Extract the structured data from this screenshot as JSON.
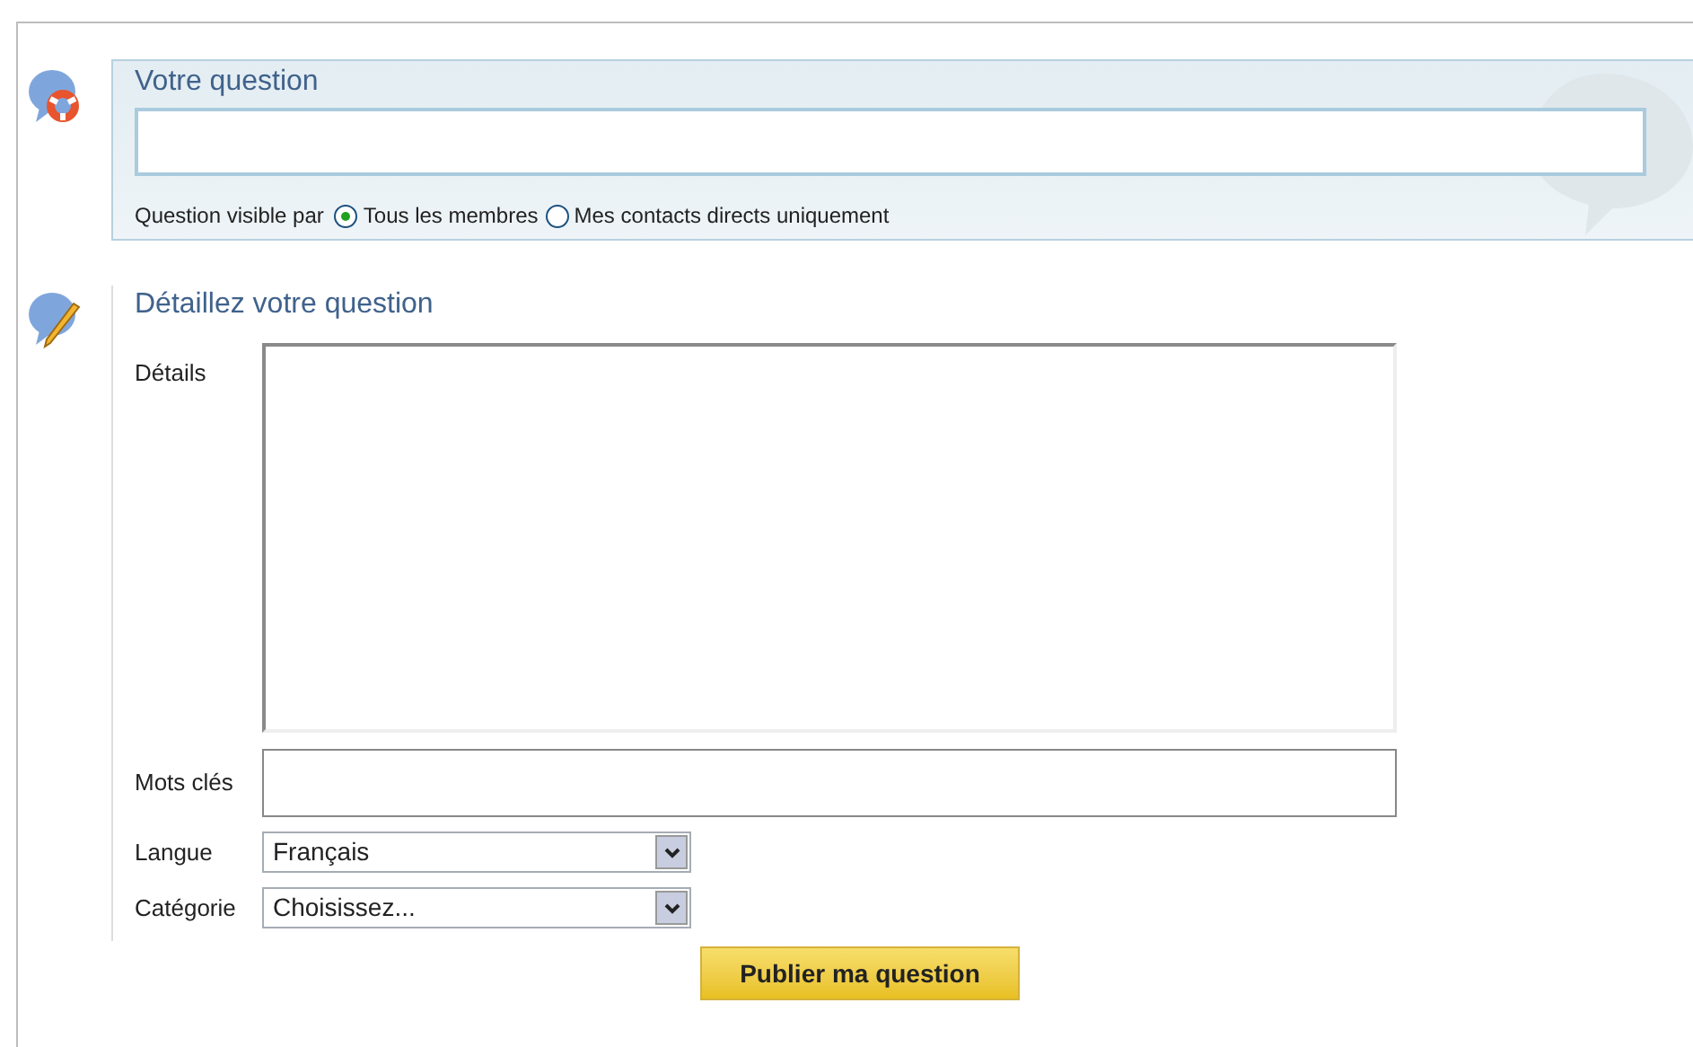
{
  "question": {
    "title": "Votre question",
    "visibility_label": "Question visible par",
    "options": [
      {
        "label": "Tous les membres",
        "selected": true
      },
      {
        "label": "Mes contacts directs uniquement",
        "selected": false
      }
    ]
  },
  "details": {
    "title": "Détaillez votre question",
    "fields": [
      {
        "kind": "textarea",
        "label": "Détails"
      },
      {
        "kind": "input",
        "label": "Mots clés"
      },
      {
        "kind": "select",
        "label": "Langue",
        "value": "Français"
      },
      {
        "kind": "select",
        "label": "Catégorie",
        "value": "Choisissez..."
      }
    ]
  },
  "submit": "Publier ma question"
}
